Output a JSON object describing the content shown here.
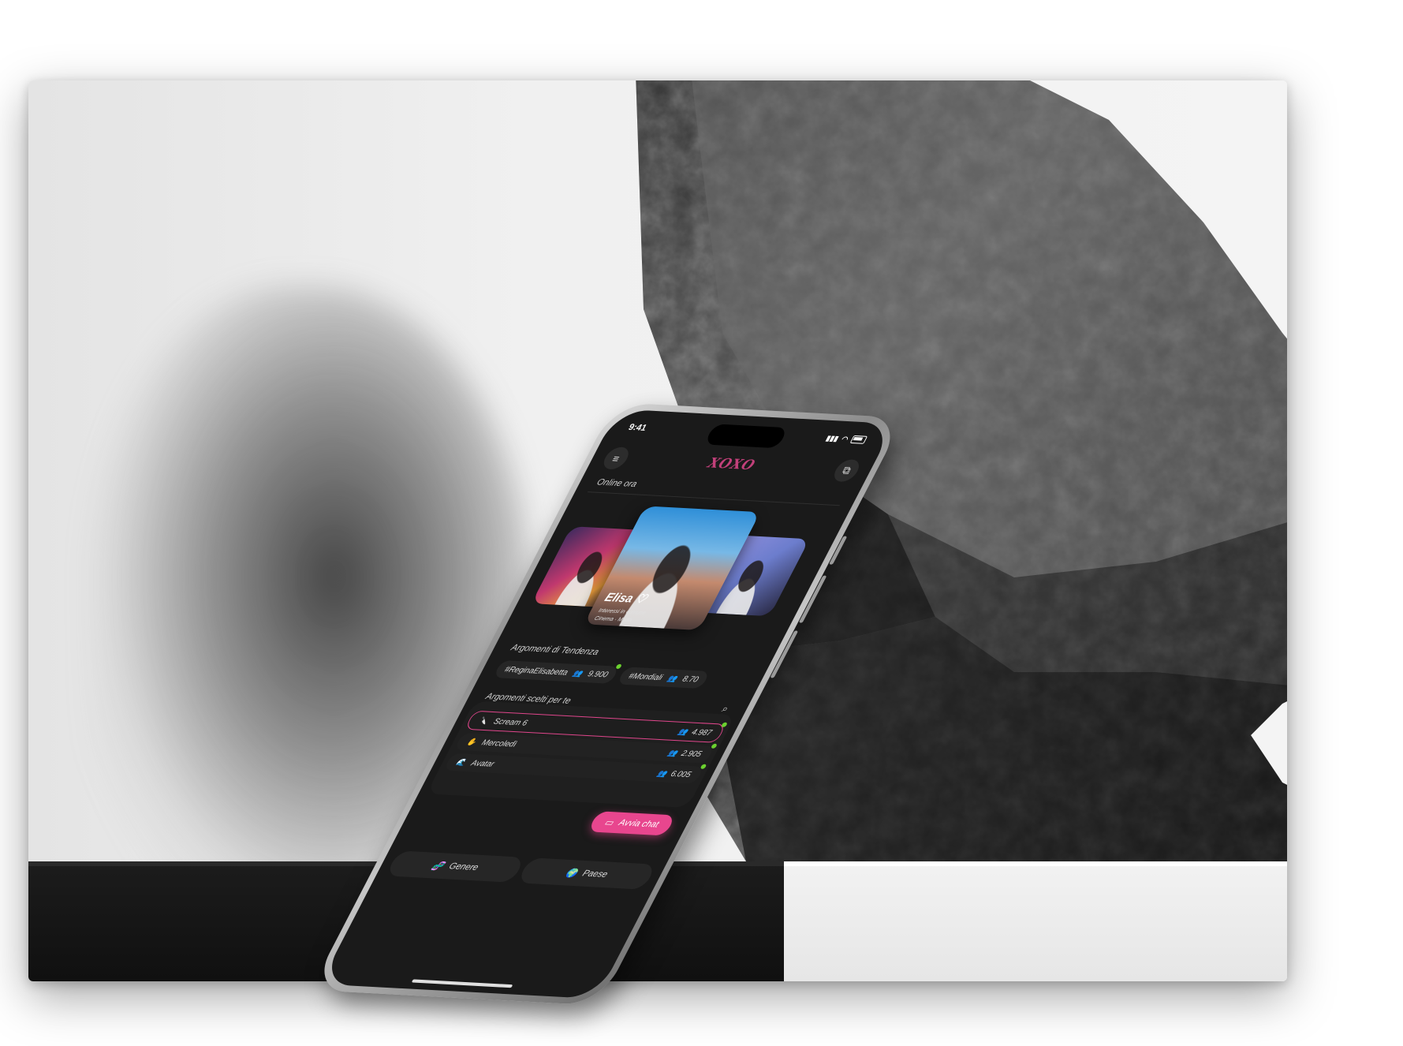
{
  "phone": {
    "status_time": "9:41",
    "logo": "XOXO",
    "menu_icon": "hamburger-icon",
    "new_chat_icon": "new-chat-icon",
    "online_label": "Online ora",
    "featured_card": {
      "name": "Elisa",
      "subtitle": "Interessi in comune",
      "tags": "Cinema · Moda"
    },
    "trending_label": "Argomenti di Tendenza",
    "trending": [
      {
        "tag": "#ReginaElisabetta",
        "count": "9.900"
      },
      {
        "tag": "#Mondiali",
        "count": "8.70"
      }
    ],
    "chosen_label": "Argomenti scelti per te",
    "topics": [
      {
        "emoji": "🔪",
        "label": "Scream 6",
        "count": "4.987",
        "active": true
      },
      {
        "emoji": "✋",
        "label": "Mercoledì",
        "count": "2.905",
        "active": false
      },
      {
        "emoji": "🌊",
        "label": "Avatar",
        "count": "6.005",
        "active": false
      }
    ],
    "cta_label": "Avvia chat",
    "tabs": [
      {
        "icon": "🧬",
        "label": "Genere"
      },
      {
        "icon": "🌍",
        "label": "Paese"
      }
    ],
    "accent_color": "#e8468e",
    "online_dot_color": "#6bd12f"
  }
}
